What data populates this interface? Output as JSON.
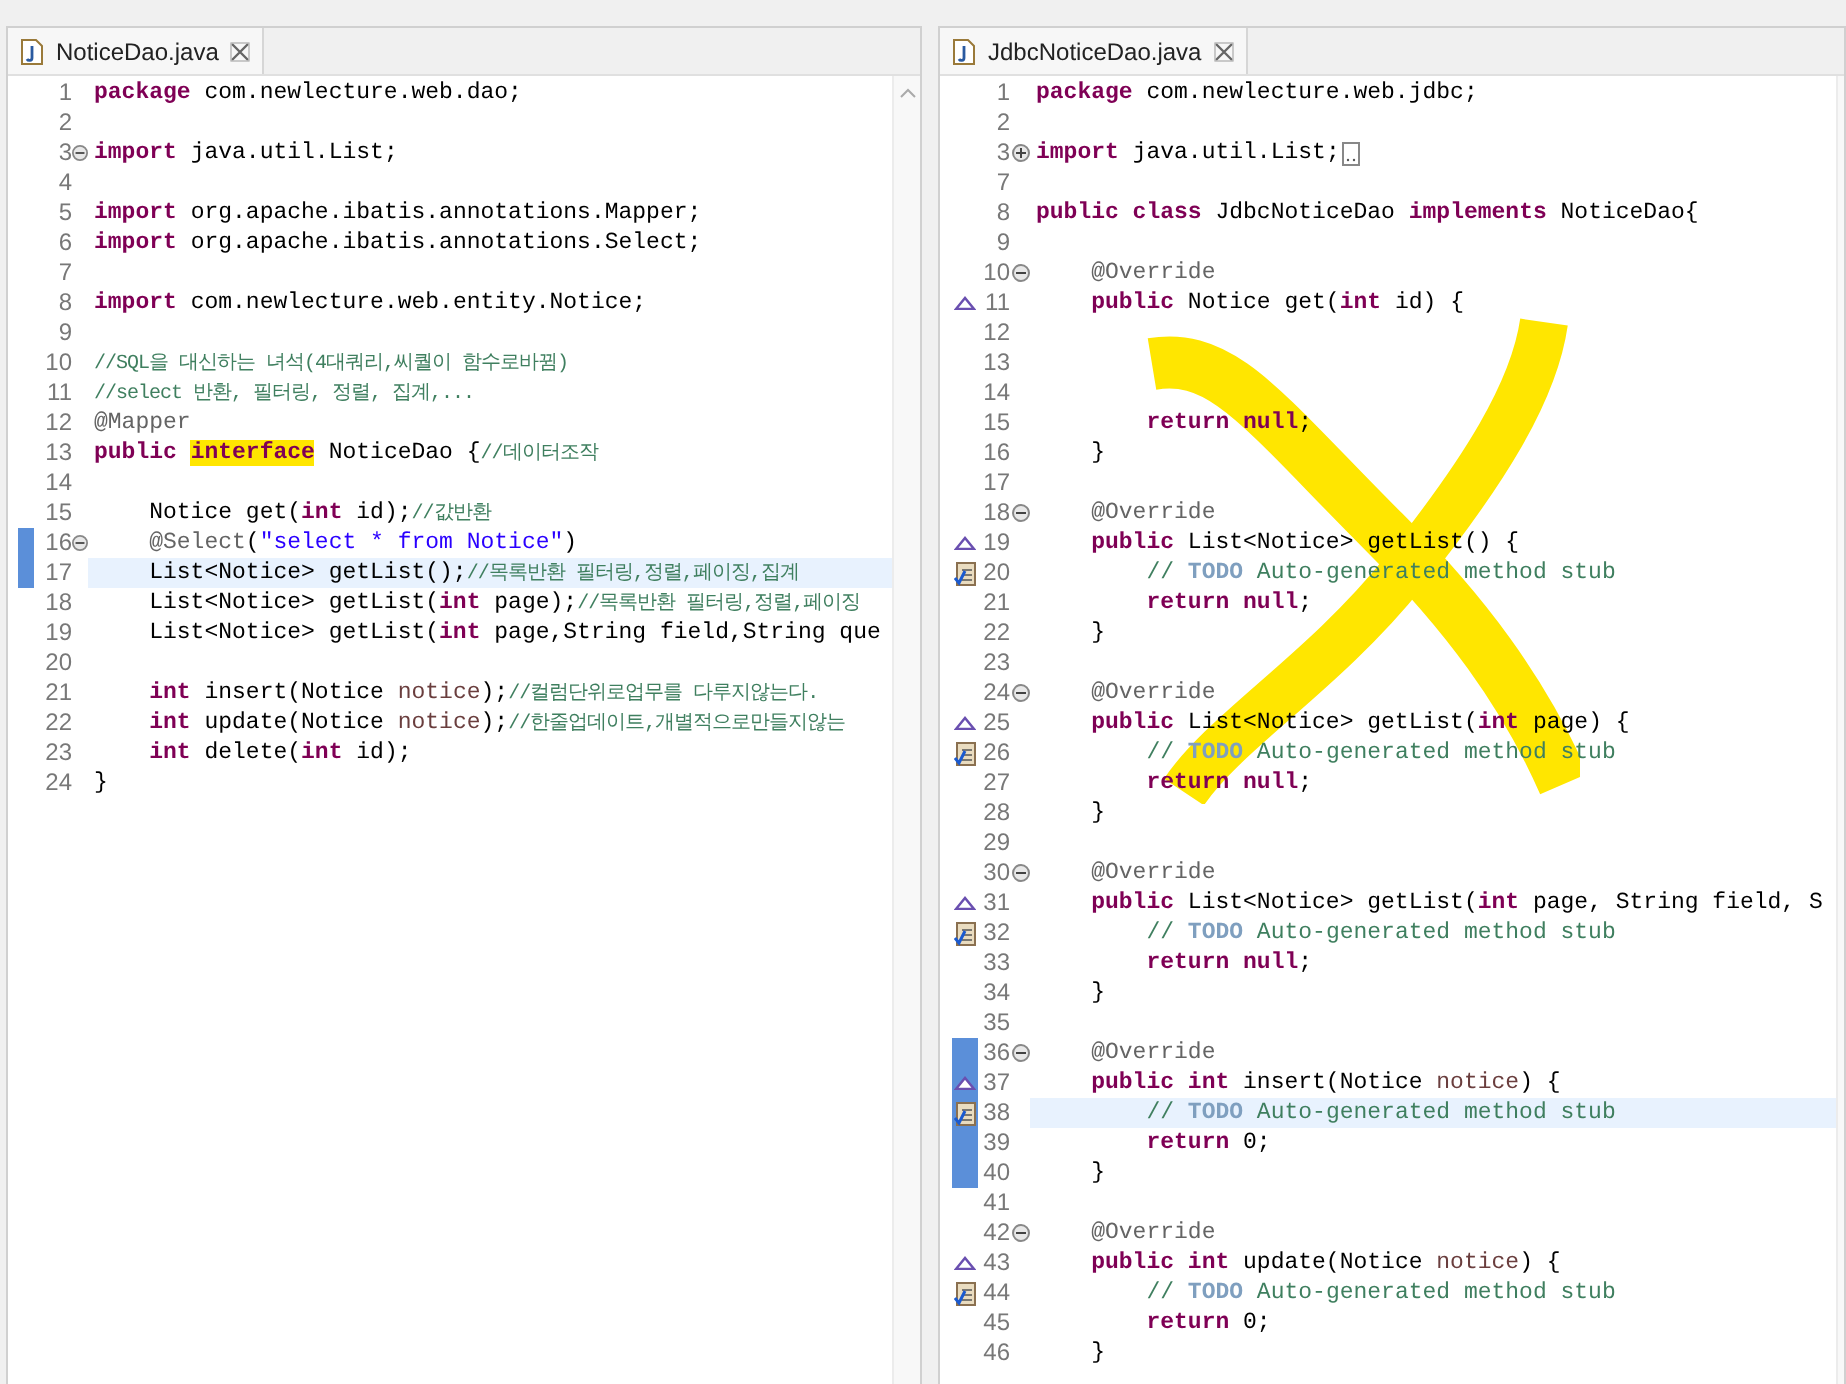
{
  "panes": [
    {
      "tab": {
        "label": "NoticeDao.java"
      },
      "lines": [
        {
          "number": "1",
          "changed": false,
          "current": false,
          "segments": [
            {
              "kind": "keyword",
              "text": "package"
            },
            {
              "kind": "plain",
              "text": " com.newlecture.web.dao;"
            }
          ]
        },
        {
          "number": "2",
          "changed": false,
          "current": false
        },
        {
          "number": "3",
          "changed": false,
          "current": false,
          "fold": {
            "kind": "collapse"
          },
          "segments": [
            {
              "kind": "keyword",
              "text": "import"
            },
            {
              "kind": "plain",
              "text": " java.util.List;"
            }
          ]
        },
        {
          "number": "4",
          "changed": false,
          "current": false
        },
        {
          "number": "5",
          "changed": false,
          "current": false,
          "segments": [
            {
              "kind": "keyword",
              "text": "import"
            },
            {
              "kind": "plain",
              "text": " org.apache.ibatis.annotations.Mapper;"
            }
          ]
        },
        {
          "number": "6",
          "changed": false,
          "current": false,
          "segments": [
            {
              "kind": "keyword",
              "text": "import"
            },
            {
              "kind": "plain",
              "text": " org.apache.ibatis.annotations.Select;"
            }
          ]
        },
        {
          "number": "7",
          "changed": false,
          "current": false
        },
        {
          "number": "8",
          "changed": false,
          "current": false,
          "segments": [
            {
              "kind": "keyword",
              "text": "import"
            },
            {
              "kind": "plain",
              "text": " com.newlecture.web.entity.Notice;"
            }
          ]
        },
        {
          "number": "9",
          "changed": false,
          "current": false
        },
        {
          "number": "10",
          "changed": false,
          "current": false,
          "segments": [
            {
              "kind": "comment",
              "text": "//SQL을 대신하는 녀석(4대쿼리,씨퀄이 함수로바뀜)"
            }
          ]
        },
        {
          "number": "11",
          "changed": false,
          "current": false,
          "segments": [
            {
              "kind": "comment",
              "text": "//select 반환, 필터링, 정렬, 집계,..."
            }
          ]
        },
        {
          "number": "12",
          "changed": false,
          "current": false,
          "segments": [
            {
              "kind": "annotation",
              "text": "@Mapper"
            }
          ]
        },
        {
          "number": "13",
          "changed": false,
          "current": false,
          "segments": [
            {
              "kind": "keyword",
              "text": "public "
            },
            {
              "kind": "marked-keyword",
              "text": "interface"
            },
            {
              "kind": "plain",
              "text": " NoticeDao {"
            },
            {
              "kind": "comment",
              "text": "//데이터조작"
            }
          ]
        },
        {
          "number": "14",
          "changed": false,
          "current": false
        },
        {
          "number": "15",
          "changed": false,
          "current": false,
          "segments": [
            {
              "kind": "plain",
              "text": "    Notice get("
            },
            {
              "kind": "keyword",
              "text": "int"
            },
            {
              "kind": "plain",
              "text": " id);"
            },
            {
              "kind": "comment",
              "text": "//값반환"
            }
          ]
        },
        {
          "number": "16",
          "changed": true,
          "current": false,
          "fold": {
            "kind": "collapse"
          },
          "segments": [
            {
              "kind": "annotation",
              "text": "    @Select"
            },
            {
              "kind": "plain",
              "text": "("
            },
            {
              "kind": "string",
              "text": "\"select * from Notice\""
            },
            {
              "kind": "plain",
              "text": ")"
            }
          ]
        },
        {
          "number": "17",
          "changed": true,
          "current": true,
          "segments": [
            {
              "kind": "plain",
              "text": "    List<Notice> getList();"
            },
            {
              "kind": "comment",
              "text": "//목록반환 필터링,정렬,페이징,집계"
            }
          ]
        },
        {
          "number": "18",
          "changed": false,
          "current": false,
          "segments": [
            {
              "kind": "plain",
              "text": "    List<Notice> getList("
            },
            {
              "kind": "keyword",
              "text": "int"
            },
            {
              "kind": "plain",
              "text": " page);"
            },
            {
              "kind": "comment",
              "text": "//목록반환 필터링,정렬,페이징"
            }
          ]
        },
        {
          "number": "19",
          "changed": false,
          "current": false,
          "segments": [
            {
              "kind": "plain",
              "text": "    List<Notice> getList("
            },
            {
              "kind": "keyword",
              "text": "int"
            },
            {
              "kind": "plain",
              "text": " page,String field,String que"
            }
          ]
        },
        {
          "number": "20",
          "changed": false,
          "current": false
        },
        {
          "number": "21",
          "changed": false,
          "current": false,
          "segments": [
            {
              "kind": "keyword",
              "text": "    int"
            },
            {
              "kind": "plain",
              "text": " insert(Notice "
            },
            {
              "kind": "variable",
              "text": "notice"
            },
            {
              "kind": "plain",
              "text": ");"
            },
            {
              "kind": "comment",
              "text": "//컬럼단위로업무를 다루지않는다."
            }
          ]
        },
        {
          "number": "22",
          "changed": false,
          "current": false,
          "segments": [
            {
              "kind": "keyword",
              "text": "    int"
            },
            {
              "kind": "plain",
              "text": " update(Notice "
            },
            {
              "kind": "variable",
              "text": "notice"
            },
            {
              "kind": "plain",
              "text": ");"
            },
            {
              "kind": "comment",
              "text": "//한줄업데이트,개별적으로만들지않는"
            }
          ]
        },
        {
          "number": "23",
          "changed": false,
          "current": false,
          "segments": [
            {
              "kind": "keyword",
              "text": "    int"
            },
            {
              "kind": "plain",
              "text": " delete("
            },
            {
              "kind": "keyword",
              "text": "int"
            },
            {
              "kind": "plain",
              "text": " id);"
            }
          ]
        },
        {
          "number": "24",
          "changed": false,
          "current": false,
          "segments": [
            {
              "kind": "plain",
              "text": "}"
            }
          ]
        }
      ]
    },
    {
      "tab": {
        "label": "JdbcNoticeDao.java"
      },
      "crossed_out": true,
      "lines": [
        {
          "number": "1",
          "changed": false,
          "current": false,
          "segments": [
            {
              "kind": "keyword",
              "text": "package"
            },
            {
              "kind": "plain",
              "text": " com.newlecture.web.jdbc;"
            }
          ]
        },
        {
          "number": "2",
          "changed": false,
          "current": false
        },
        {
          "number": "3",
          "changed": false,
          "current": false,
          "fold": {
            "kind": "expand"
          },
          "folded_hint": true,
          "segments": [
            {
              "kind": "keyword",
              "text": "import"
            },
            {
              "kind": "plain",
              "text": " java.util.List;"
            }
          ]
        },
        {
          "number": "7",
          "changed": false,
          "current": false
        },
        {
          "number": "8",
          "changed": false,
          "current": false,
          "segments": [
            {
              "kind": "keyword",
              "text": "public class"
            },
            {
              "kind": "plain",
              "text": " JdbcNoticeDao "
            },
            {
              "kind": "keyword",
              "text": "implements"
            },
            {
              "kind": "plain",
              "text": " NoticeDao{"
            }
          ]
        },
        {
          "number": "9",
          "changed": false,
          "current": false
        },
        {
          "number": "10",
          "changed": false,
          "current": false,
          "fold": {
            "kind": "collapse"
          },
          "segments": [
            {
              "kind": "annotation",
              "text": "    @Override"
            }
          ]
        },
        {
          "number": "11",
          "changed": false,
          "current": false,
          "marker": {
            "kind": "override"
          },
          "segments": [
            {
              "kind": "keyword",
              "text": "    public"
            },
            {
              "kind": "plain",
              "text": " Notice get("
            },
            {
              "kind": "keyword",
              "text": "int"
            },
            {
              "kind": "plain",
              "text": " id) {"
            }
          ]
        },
        {
          "number": "12",
          "changed": false,
          "current": false
        },
        {
          "number": "13",
          "changed": false,
          "current": false
        },
        {
          "number": "14",
          "changed": false,
          "current": false
        },
        {
          "number": "15",
          "changed": false,
          "current": false,
          "segments": [
            {
              "kind": "keyword",
              "text": "        return null"
            },
            {
              "kind": "plain",
              "text": ";"
            }
          ]
        },
        {
          "number": "16",
          "changed": false,
          "current": false,
          "segments": [
            {
              "kind": "plain",
              "text": "    }"
            }
          ]
        },
        {
          "number": "17",
          "changed": false,
          "current": false
        },
        {
          "number": "18",
          "changed": false,
          "current": false,
          "fold": {
            "kind": "collapse"
          },
          "segments": [
            {
              "kind": "annotation",
              "text": "    @Override"
            }
          ]
        },
        {
          "number": "19",
          "changed": false,
          "current": false,
          "marker": {
            "kind": "override"
          },
          "segments": [
            {
              "kind": "keyword",
              "text": "    public"
            },
            {
              "kind": "plain",
              "text": " List<Notice> getList() {"
            }
          ]
        },
        {
          "number": "20",
          "changed": false,
          "current": false,
          "marker": {
            "kind": "task"
          },
          "segments": [
            {
              "kind": "comment",
              "text": "        //"
            },
            {
              "kind": "todo",
              "text": " TODO"
            },
            {
              "kind": "comment",
              "text": " Auto-generated method stub"
            }
          ]
        },
        {
          "number": "21",
          "changed": false,
          "current": false,
          "segments": [
            {
              "kind": "keyword",
              "text": "        return null"
            },
            {
              "kind": "plain",
              "text": ";"
            }
          ]
        },
        {
          "number": "22",
          "changed": false,
          "current": false,
          "segments": [
            {
              "kind": "plain",
              "text": "    }"
            }
          ]
        },
        {
          "number": "23",
          "changed": false,
          "current": false
        },
        {
          "number": "24",
          "changed": false,
          "current": false,
          "fold": {
            "kind": "collapse"
          },
          "segments": [
            {
              "kind": "annotation",
              "text": "    @Override"
            }
          ]
        },
        {
          "number": "25",
          "changed": false,
          "current": false,
          "marker": {
            "kind": "override"
          },
          "segments": [
            {
              "kind": "keyword",
              "text": "    public"
            },
            {
              "kind": "plain",
              "text": " List<Notice> getList("
            },
            {
              "kind": "keyword",
              "text": "int"
            },
            {
              "kind": "plain",
              "text": " page) {"
            }
          ]
        },
        {
          "number": "26",
          "changed": false,
          "current": false,
          "marker": {
            "kind": "task"
          },
          "segments": [
            {
              "kind": "comment",
              "text": "        //"
            },
            {
              "kind": "todo",
              "text": " TODO"
            },
            {
              "kind": "comment",
              "text": " Auto-generated method stub"
            }
          ]
        },
        {
          "number": "27",
          "changed": false,
          "current": false,
          "segments": [
            {
              "kind": "keyword",
              "text": "        return null"
            },
            {
              "kind": "plain",
              "text": ";"
            }
          ]
        },
        {
          "number": "28",
          "changed": false,
          "current": false,
          "segments": [
            {
              "kind": "plain",
              "text": "    }"
            }
          ]
        },
        {
          "number": "29",
          "changed": false,
          "current": false
        },
        {
          "number": "30",
          "changed": false,
          "current": false,
          "fold": {
            "kind": "collapse"
          },
          "segments": [
            {
              "kind": "annotation",
              "text": "    @Override"
            }
          ]
        },
        {
          "number": "31",
          "changed": false,
          "current": false,
          "marker": {
            "kind": "override"
          },
          "segments": [
            {
              "kind": "keyword",
              "text": "    public"
            },
            {
              "kind": "plain",
              "text": " List<Notice> getList("
            },
            {
              "kind": "keyword",
              "text": "int"
            },
            {
              "kind": "plain",
              "text": " page, String field, S"
            }
          ]
        },
        {
          "number": "32",
          "changed": false,
          "current": false,
          "marker": {
            "kind": "task"
          },
          "segments": [
            {
              "kind": "comment",
              "text": "        //"
            },
            {
              "kind": "todo",
              "text": " TODO"
            },
            {
              "kind": "comment",
              "text": " Auto-generated method stub"
            }
          ]
        },
        {
          "number": "33",
          "changed": false,
          "current": false,
          "segments": [
            {
              "kind": "keyword",
              "text": "        return null"
            },
            {
              "kind": "plain",
              "text": ";"
            }
          ]
        },
        {
          "number": "34",
          "changed": false,
          "current": false,
          "segments": [
            {
              "kind": "plain",
              "text": "    }"
            }
          ]
        },
        {
          "number": "35",
          "changed": false,
          "current": false
        },
        {
          "number": "36",
          "changed": true,
          "current": false,
          "fold": {
            "kind": "collapse"
          },
          "segments": [
            {
              "kind": "annotation",
              "text": "    @Override"
            }
          ]
        },
        {
          "number": "37",
          "changed": true,
          "current": false,
          "marker": {
            "kind": "override"
          },
          "segments": [
            {
              "kind": "keyword",
              "text": "    public int"
            },
            {
              "kind": "plain",
              "text": " insert(Notice "
            },
            {
              "kind": "variable",
              "text": "notice"
            },
            {
              "kind": "plain",
              "text": ") {"
            }
          ]
        },
        {
          "number": "38",
          "changed": true,
          "current": true,
          "marker": {
            "kind": "task"
          },
          "segments": [
            {
              "kind": "comment",
              "text": "        //"
            },
            {
              "kind": "todo",
              "text": " TODO"
            },
            {
              "kind": "comment",
              "text": " Auto-generated method stub"
            }
          ]
        },
        {
          "number": "39",
          "changed": true,
          "current": false,
          "segments": [
            {
              "kind": "keyword",
              "text": "        return"
            },
            {
              "kind": "plain",
              "text": " 0;"
            }
          ]
        },
        {
          "number": "40",
          "changed": true,
          "current": false,
          "segments": [
            {
              "kind": "plain",
              "text": "    }"
            }
          ]
        },
        {
          "number": "41",
          "changed": false,
          "current": false
        },
        {
          "number": "42",
          "changed": false,
          "current": false,
          "fold": {
            "kind": "collapse"
          },
          "segments": [
            {
              "kind": "annotation",
              "text": "    @Override"
            }
          ]
        },
        {
          "number": "43",
          "changed": false,
          "current": false,
          "marker": {
            "kind": "override"
          },
          "segments": [
            {
              "kind": "keyword",
              "text": "    public int"
            },
            {
              "kind": "plain",
              "text": " update(Notice "
            },
            {
              "kind": "variable",
              "text": "notice"
            },
            {
              "kind": "plain",
              "text": ") {"
            }
          ]
        },
        {
          "number": "44",
          "changed": false,
          "current": false,
          "marker": {
            "kind": "task"
          },
          "segments": [
            {
              "kind": "comment",
              "text": "        //"
            },
            {
              "kind": "todo",
              "text": " TODO"
            },
            {
              "kind": "comment",
              "text": " Auto-generated method stub"
            }
          ]
        },
        {
          "number": "45",
          "changed": false,
          "current": false,
          "segments": [
            {
              "kind": "keyword",
              "text": "        return"
            },
            {
              "kind": "plain",
              "text": " 0;"
            }
          ]
        },
        {
          "number": "46",
          "changed": false,
          "current": false,
          "segments": [
            {
              "kind": "plain",
              "text": "    }"
            }
          ]
        }
      ]
    }
  ]
}
